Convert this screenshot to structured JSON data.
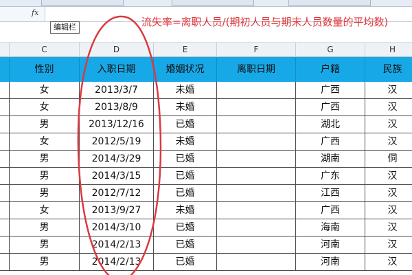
{
  "formula_bar": {
    "fx_label": "fx",
    "value": "",
    "tooltip": "编辑栏"
  },
  "annotation": {
    "text": "流失率=离职人员/(期初人员与期末人员数量的平均数)",
    "color": "#e0353a"
  },
  "sheet": {
    "column_letters": [
      "C",
      "D",
      "E",
      "F",
      "G",
      "H"
    ],
    "headers": [
      "性别",
      "入职日期",
      "婚姻状况",
      "离职日期",
      "户籍",
      "民族"
    ],
    "header_bg": "#17a8e7",
    "rows": [
      {
        "gender": "女",
        "hire_date": "2013/3/7",
        "marital": "未婚",
        "leave_date": "",
        "domicile": "广西",
        "ethnicity": "汉"
      },
      {
        "gender": "女",
        "hire_date": "2013/8/9",
        "marital": "未婚",
        "leave_date": "",
        "domicile": "广西",
        "ethnicity": "汉"
      },
      {
        "gender": "男",
        "hire_date": "2013/12/16",
        "marital": "已婚",
        "leave_date": "",
        "domicile": "湖北",
        "ethnicity": "汉"
      },
      {
        "gender": "女",
        "hire_date": "2012/5/19",
        "marital": "未婚",
        "leave_date": "",
        "domicile": "广西",
        "ethnicity": "汉"
      },
      {
        "gender": "男",
        "hire_date": "2014/3/29",
        "marital": "已婚",
        "leave_date": "",
        "domicile": "湖南",
        "ethnicity": "侗"
      },
      {
        "gender": "男",
        "hire_date": "2014/3/15",
        "marital": "已婚",
        "leave_date": "",
        "domicile": "广东",
        "ethnicity": "汉"
      },
      {
        "gender": "男",
        "hire_date": "2012/7/12",
        "marital": "已婚",
        "leave_date": "",
        "domicile": "江西",
        "ethnicity": "汉"
      },
      {
        "gender": "女",
        "hire_date": "2013/9/27",
        "marital": "未婚",
        "leave_date": "",
        "domicile": "广西",
        "ethnicity": "汉"
      },
      {
        "gender": "男",
        "hire_date": "2014/3/10",
        "marital": "已婚",
        "leave_date": "",
        "domicile": "海南",
        "ethnicity": "汉"
      },
      {
        "gender": "男",
        "hire_date": "2014/2/13",
        "marital": "已婚",
        "leave_date": "",
        "domicile": "河南",
        "ethnicity": "汉"
      },
      {
        "gender": "男",
        "hire_date": "2014/2/13",
        "marital": "已婚",
        "leave_date": "",
        "domicile": "河南",
        "ethnicity": "汉"
      }
    ]
  }
}
